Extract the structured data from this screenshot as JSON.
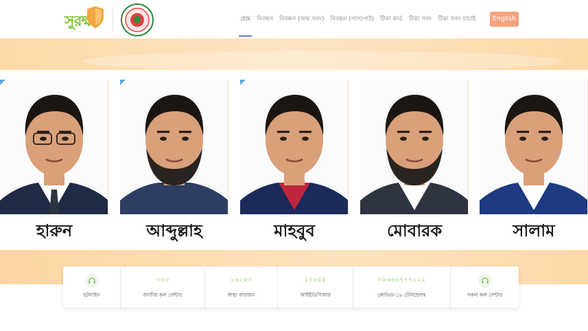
{
  "header": {
    "logo_text": "সুরক্ষা",
    "nav": [
      {
        "label": "হোম",
        "active": true
      },
      {
        "label": "নিবন্ধন",
        "active": false
      },
      {
        "label": "নিবন্ধন (জন্ম সনদ)",
        "active": false
      },
      {
        "label": "নিবন্ধন (পাসপোর্ট)",
        "active": false
      },
      {
        "label": "টিকা কার্ড",
        "active": false
      },
      {
        "label": "টিকা সনদ",
        "active": false
      },
      {
        "label": "টিকা সনদ যাচাই",
        "active": false
      }
    ],
    "language_button": "English"
  },
  "people": [
    {
      "name": "হারুন",
      "shirt": "#ffffff",
      "suit": "#1f2a44",
      "tie": "#2c3340",
      "glasses": true,
      "beard": false
    },
    {
      "name": "আব্দুল্লাহ",
      "shirt": "#2d3d63",
      "suit": "#2d3d63",
      "tie": "",
      "glasses": false,
      "beard": true
    },
    {
      "name": "মাহবুব",
      "shirt": "#c0263b",
      "suit": "#1b2a58",
      "tie": "",
      "glasses": false,
      "beard": false
    },
    {
      "name": "মোবারক",
      "shirt": "#ffffff",
      "suit": "#2e3440",
      "tie": "",
      "glasses": false,
      "beard": true
    },
    {
      "name": "সালাম",
      "shirt": "#ffffff",
      "suit": "#1d3a82",
      "tie": "",
      "glasses": false,
      "beard": false
    }
  ],
  "info": [
    {
      "number": "",
      "label": "হটলাইন",
      "icon": "headset-icon"
    },
    {
      "number": "৩৩৩",
      "label": "জাতীয় কল সেন্টার",
      "icon": ""
    },
    {
      "number": "১৬২৬৩",
      "label": "স্বাস্থ্য বাতায়ন",
      "icon": ""
    },
    {
      "number": "১০৬৫৫",
      "label": "আইইডিসিআর",
      "icon": ""
    },
    {
      "number": "০৯৬৬৬৭৭৭২২২",
      "label": "কোভিড-১৯ টেলিহেলথ",
      "icon": ""
    },
    {
      "number": "",
      "label": "সকল কল সেন্টার",
      "icon": "headset-icon"
    }
  ],
  "colors": {
    "accent": "#f5a27f",
    "peach": "#fcd9a8",
    "green": "#86c440"
  }
}
